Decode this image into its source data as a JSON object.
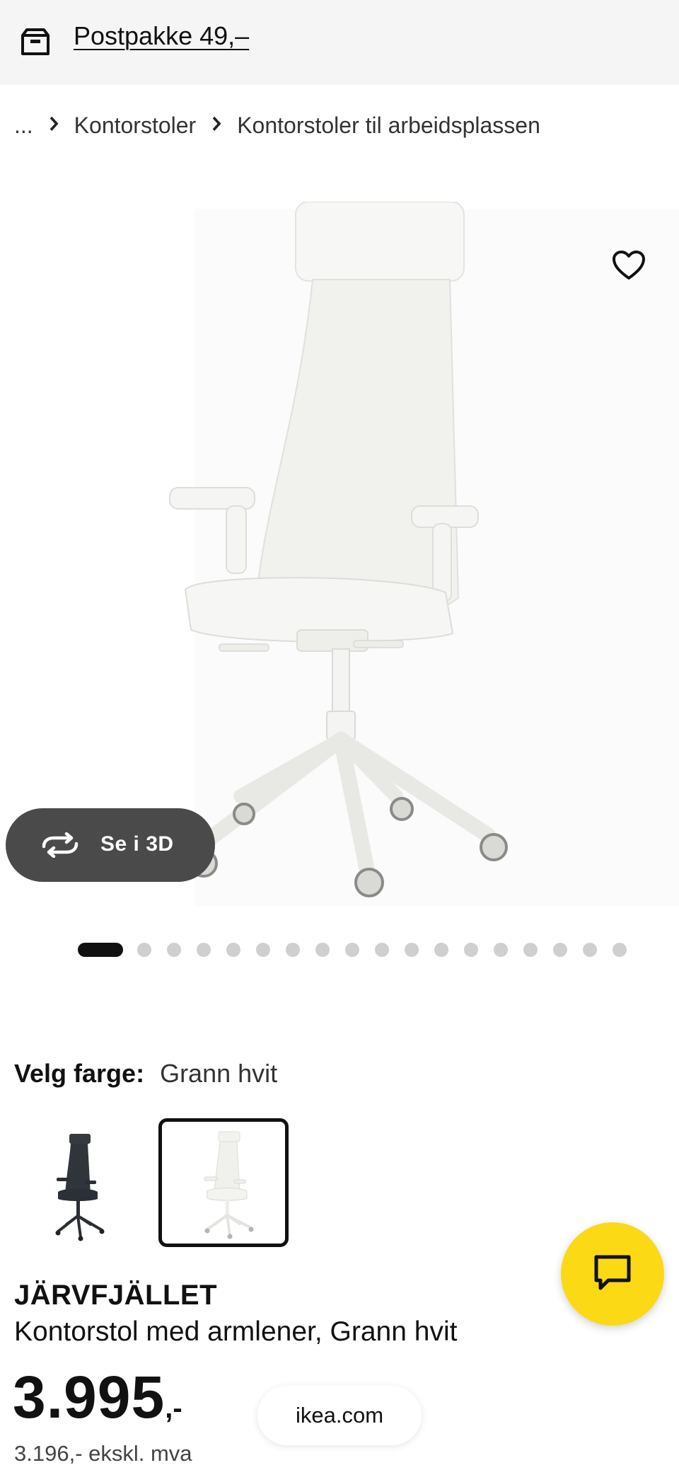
{
  "delivery": {
    "icon": "delivery-box-icon",
    "text": "Postpakke 49,–"
  },
  "breadcrumb": {
    "ellipsis": "...",
    "items": [
      "Kontorstoler",
      "Kontorstoler til arbeidsplassen"
    ],
    "separator_icon": "chevron-right-icon"
  },
  "gallery": {
    "favorite_icon": "heart-outline-icon",
    "view3d_label": "Se i 3D",
    "view3d_icon": "rotate-3d-icon",
    "total_images": 18,
    "active_index": 0
  },
  "color": {
    "label": "Velg farge:",
    "selected": "Grann hvit",
    "options": [
      {
        "name": "black-chair-swatch",
        "selected": false
      },
      {
        "name": "white-chair-swatch",
        "selected": true
      }
    ]
  },
  "product": {
    "name": "JÄRVFJÄLLET",
    "description": "Kontorstol med armlener, Grann hvit",
    "price": "3.995",
    "price_suffix": ",-",
    "price_excl_vat": "3.196,- ekskl. mva"
  },
  "browser": {
    "url": "ikea.com"
  },
  "chat": {
    "icon": "chat-bubble-icon",
    "color": "#fbd914"
  }
}
